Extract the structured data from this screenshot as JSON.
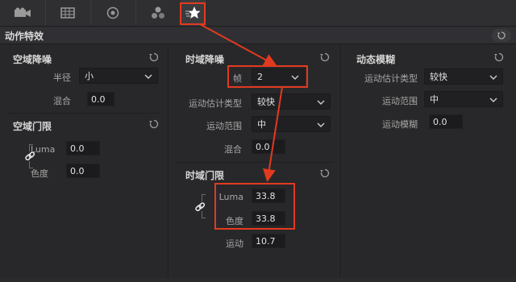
{
  "toolbar": {
    "tools": [
      {
        "name": "camera-icon"
      },
      {
        "name": "grid-icon"
      },
      {
        "name": "circle-dot-icon"
      },
      {
        "name": "color-dots-icon"
      },
      {
        "name": "star-effects-icon"
      }
    ],
    "active_index": 4
  },
  "header": {
    "title": "动作特效"
  },
  "panel_spatial": {
    "title": "空域降噪",
    "radius_label": "半径",
    "radius_value": "小",
    "blend_label": "混合",
    "blend_value": "0.0",
    "threshold_title": "空域门限",
    "luma_label": "Luma",
    "luma_value": "0.0",
    "chroma_label": "色度",
    "chroma_value": "0.0"
  },
  "panel_temporal": {
    "title": "时域降噪",
    "frames_label": "帧",
    "frames_value": "2",
    "motion_type_label": "运动估计类型",
    "motion_type_value": "较快",
    "motion_range_label": "运动范围",
    "motion_range_value": "中",
    "blend_label": "混合",
    "blend_value": "0.0",
    "threshold_title": "时域门限",
    "luma_label": "Luma",
    "luma_value": "33.8",
    "chroma_label": "色度",
    "chroma_value": "33.8",
    "motion_label": "运动",
    "motion_value": "10.7"
  },
  "panel_motion_blur": {
    "title": "动态模糊",
    "motion_type_label": "运动估计类型",
    "motion_type_value": "较快",
    "motion_range_label": "运动范围",
    "motion_range_value": "中",
    "motion_blur_label": "运动模糊",
    "motion_blur_value": "0.0"
  },
  "colors": {
    "accent_red": "#e23a1f",
    "background": "#2b2b2d",
    "field_bg": "#1b1b1d"
  }
}
